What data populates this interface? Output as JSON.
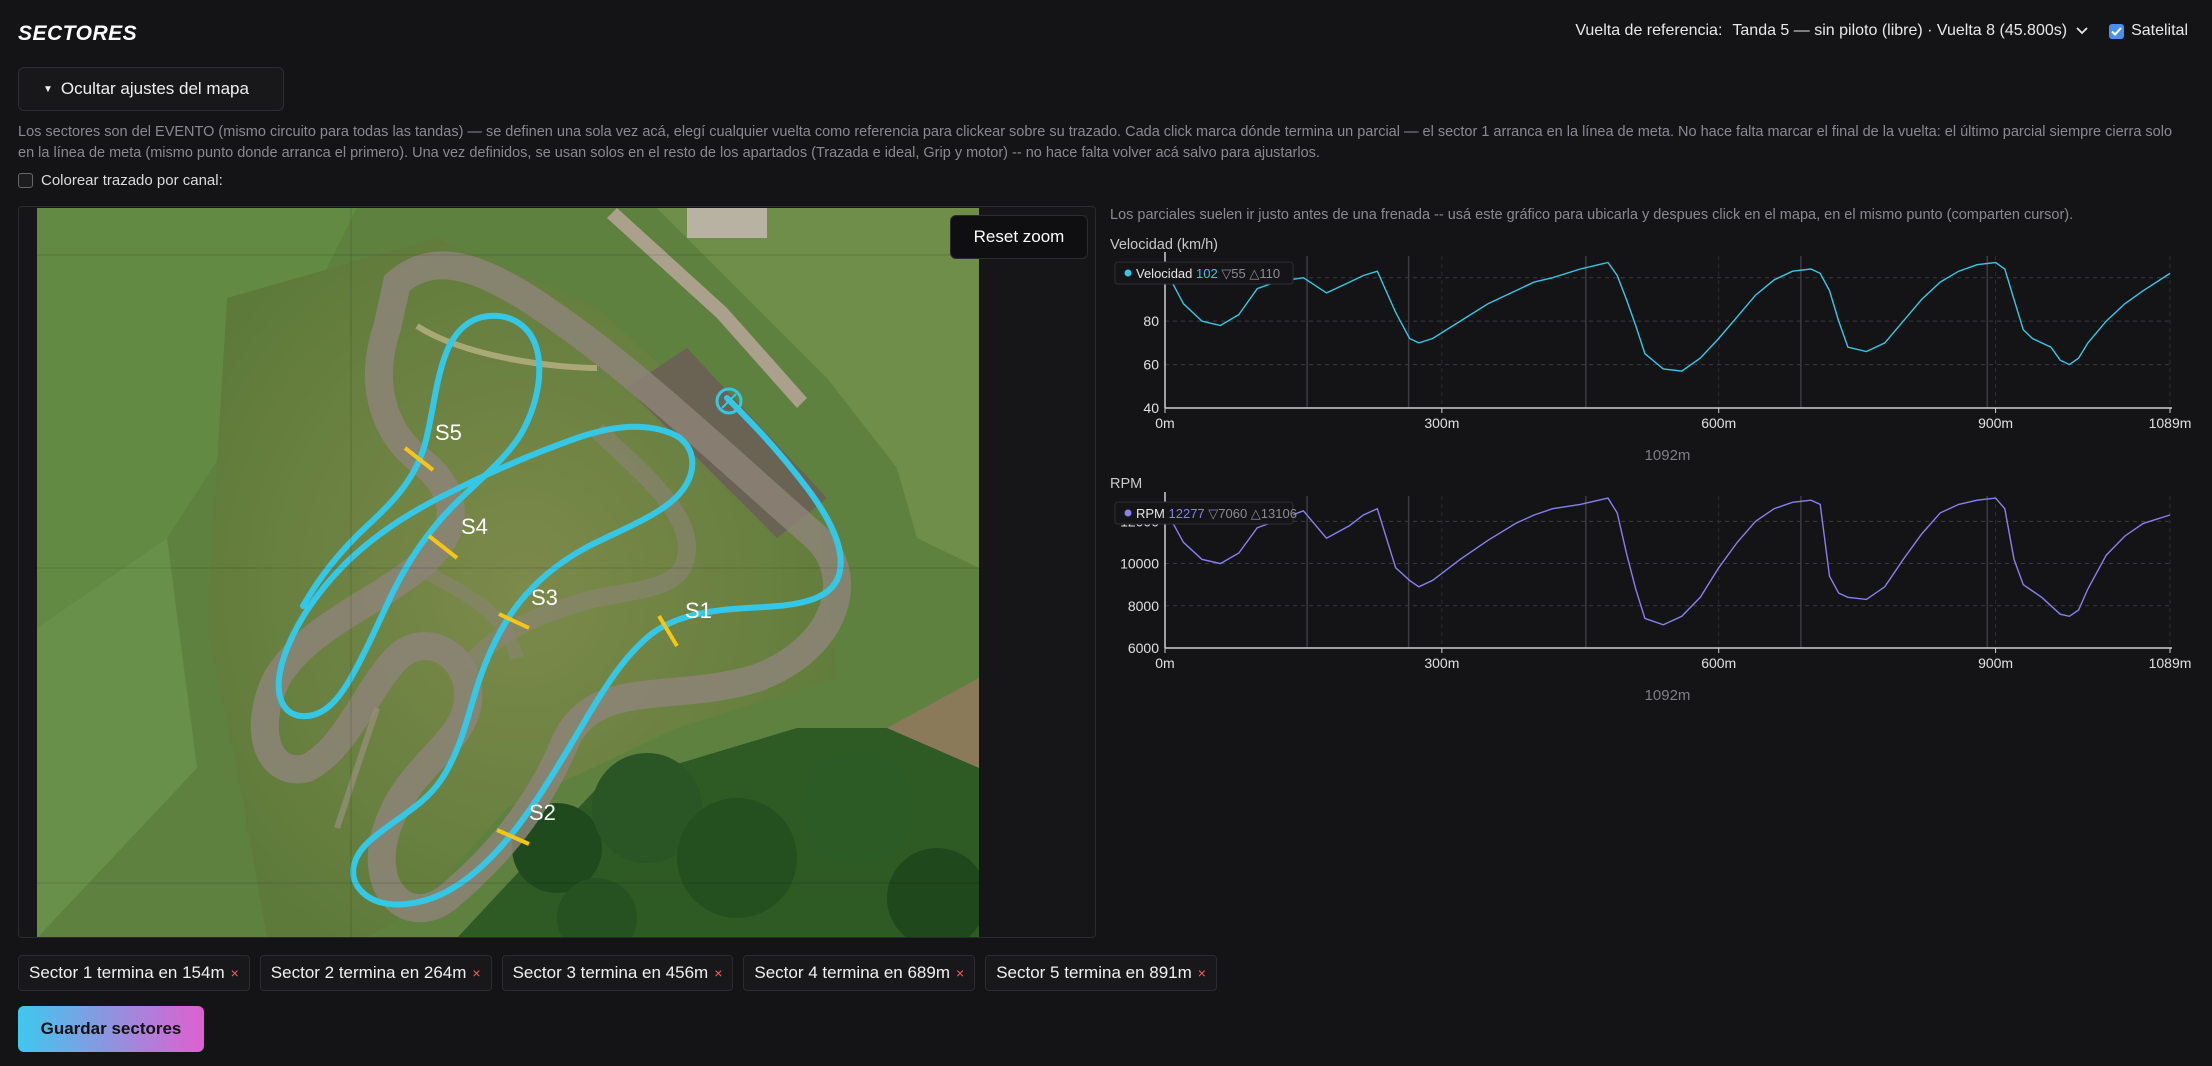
{
  "header": {
    "title": "SECTORES",
    "ref_label": "Vuelta de referencia:",
    "ref_value": "Tanda 5 — sin piloto (libre) · Vuelta 8 (45.800s)",
    "satellite_label": "Satelital",
    "satellite_checked": true
  },
  "map_settings": {
    "toggle_label": "Ocultar ajustes del mapa",
    "description": "Los sectores son del EVENTO (mismo circuito para todas las tandas) — se definen una sola vez acá, elegí cualquier vuelta como referencia para clickear sobre su trazado. Cada click marca dónde termina un parcial — el sector 1 arranca en la línea de meta. No hace falta marcar el final de la vuelta: el último parcial siempre cierra solo en la línea de meta (mismo punto donde arranca el primero). Una vez definidos, se usan solos en el resto de los apartados (Trazada e ideal, Grip y motor) -- no hace falta volver acá salvo para ajustarlos.",
    "color_by_channel_label": "Colorear trazado por canal:",
    "color_by_channel_checked": false
  },
  "map": {
    "reset_zoom_label": "Reset zoom",
    "markers": [
      "S1",
      "S2",
      "S3",
      "S4",
      "S5"
    ],
    "track_color": "#35c8e6",
    "marker_color": "#f5c518"
  },
  "charts_hint": "Los parciales suelen ir justo antes de una frenada -- usá este gráfico para ubicarla y despues click en el mapa, en el mismo punto (comparten cursor).",
  "chart_data": [
    {
      "type": "line",
      "title": "Velocidad (km/h)",
      "legend": {
        "name": "Velocidad",
        "current": "102",
        "min": "▽55",
        "max": "△110"
      },
      "color": "#35c8e6",
      "x_ticks": [
        "0m",
        "300m",
        "600m",
        "900m",
        "1089m"
      ],
      "x_tick_values": [
        0,
        300,
        600,
        900,
        1089
      ],
      "y_ticks": [
        "100",
        "80",
        "60",
        "40"
      ],
      "y_tick_values": [
        100,
        80,
        60,
        40
      ],
      "ylim": [
        40,
        110
      ],
      "xlim": [
        0,
        1089
      ],
      "xlabel": "1092m",
      "sector_lines": [
        154,
        264,
        456,
        689,
        891
      ],
      "x": [
        0,
        20,
        40,
        60,
        80,
        100,
        120,
        150,
        175,
        200,
        215,
        230,
        250,
        265,
        275,
        290,
        320,
        350,
        380,
        400,
        420,
        450,
        470,
        480,
        490,
        500,
        510,
        520,
        540,
        560,
        580,
        600,
        620,
        640,
        660,
        680,
        700,
        710,
        720,
        730,
        740,
        760,
        780,
        800,
        820,
        840,
        860,
        880,
        900,
        910,
        920,
        930,
        940,
        950,
        960,
        970,
        980,
        990,
        1000,
        1020,
        1040,
        1060,
        1089
      ],
      "y": [
        104,
        88,
        80,
        78,
        83,
        95,
        98,
        100,
        93,
        98,
        101,
        103,
        84,
        72,
        70,
        72,
        80,
        88,
        94,
        98,
        100,
        104,
        106,
        107,
        101,
        90,
        78,
        65,
        58,
        57,
        63,
        72,
        82,
        92,
        99,
        103,
        104,
        102,
        94,
        80,
        68,
        66,
        70,
        80,
        90,
        98,
        103,
        106,
        107,
        104,
        90,
        76,
        72,
        70,
        68,
        62,
        60,
        63,
        70,
        80,
        88,
        94,
        102
      ]
    },
    {
      "type": "line",
      "title": "RPM",
      "legend": {
        "name": "RPM",
        "current": "12277",
        "min": "▽7060",
        "max": "△13106"
      },
      "color": "#8b7ef0",
      "x_ticks": [
        "0m",
        "300m",
        "600m",
        "900m",
        "1089m"
      ],
      "x_tick_values": [
        0,
        300,
        600,
        900,
        1089
      ],
      "y_ticks": [
        "12000",
        "10000",
        "8000",
        "6000"
      ],
      "y_tick_values": [
        12000,
        10000,
        8000,
        6000
      ],
      "ylim": [
        6000,
        13200
      ],
      "xlim": [
        0,
        1089
      ],
      "xlabel": "1092m",
      "sector_lines": [
        154,
        264,
        456,
        689,
        891
      ],
      "x": [
        0,
        20,
        40,
        60,
        80,
        100,
        120,
        150,
        175,
        200,
        215,
        230,
        250,
        265,
        275,
        290,
        320,
        350,
        380,
        400,
        420,
        450,
        470,
        480,
        490,
        500,
        510,
        520,
        540,
        560,
        580,
        600,
        620,
        640,
        660,
        680,
        700,
        710,
        720,
        730,
        740,
        760,
        780,
        800,
        820,
        840,
        860,
        880,
        900,
        910,
        920,
        930,
        940,
        950,
        960,
        970,
        980,
        990,
        1000,
        1020,
        1040,
        1060,
        1089
      ],
      "y": [
        12600,
        11000,
        10200,
        10000,
        10500,
        11700,
        12000,
        12500,
        11200,
        11800,
        12300,
        12600,
        9800,
        9200,
        8900,
        9200,
        10200,
        11100,
        11900,
        12300,
        12600,
        12800,
        13000,
        13100,
        12400,
        10500,
        8800,
        7400,
        7100,
        7500,
        8400,
        9800,
        11000,
        12000,
        12600,
        12900,
        13000,
        12800,
        9400,
        8600,
        8400,
        8300,
        8900,
        10200,
        11400,
        12400,
        12800,
        13000,
        13100,
        12600,
        10200,
        9000,
        8700,
        8400,
        8000,
        7600,
        7500,
        7800,
        8800,
        10400,
        11300,
        11900,
        12300
      ]
    }
  ],
  "sectors": [
    {
      "label": "Sector 1 termina en 154m"
    },
    {
      "label": "Sector 2 termina en 264m"
    },
    {
      "label": "Sector 3 termina en 456m"
    },
    {
      "label": "Sector 4 termina en 689m"
    },
    {
      "label": "Sector 5 termina en 891m"
    }
  ],
  "remove_symbol": "×",
  "save_label": "Guardar sectores"
}
